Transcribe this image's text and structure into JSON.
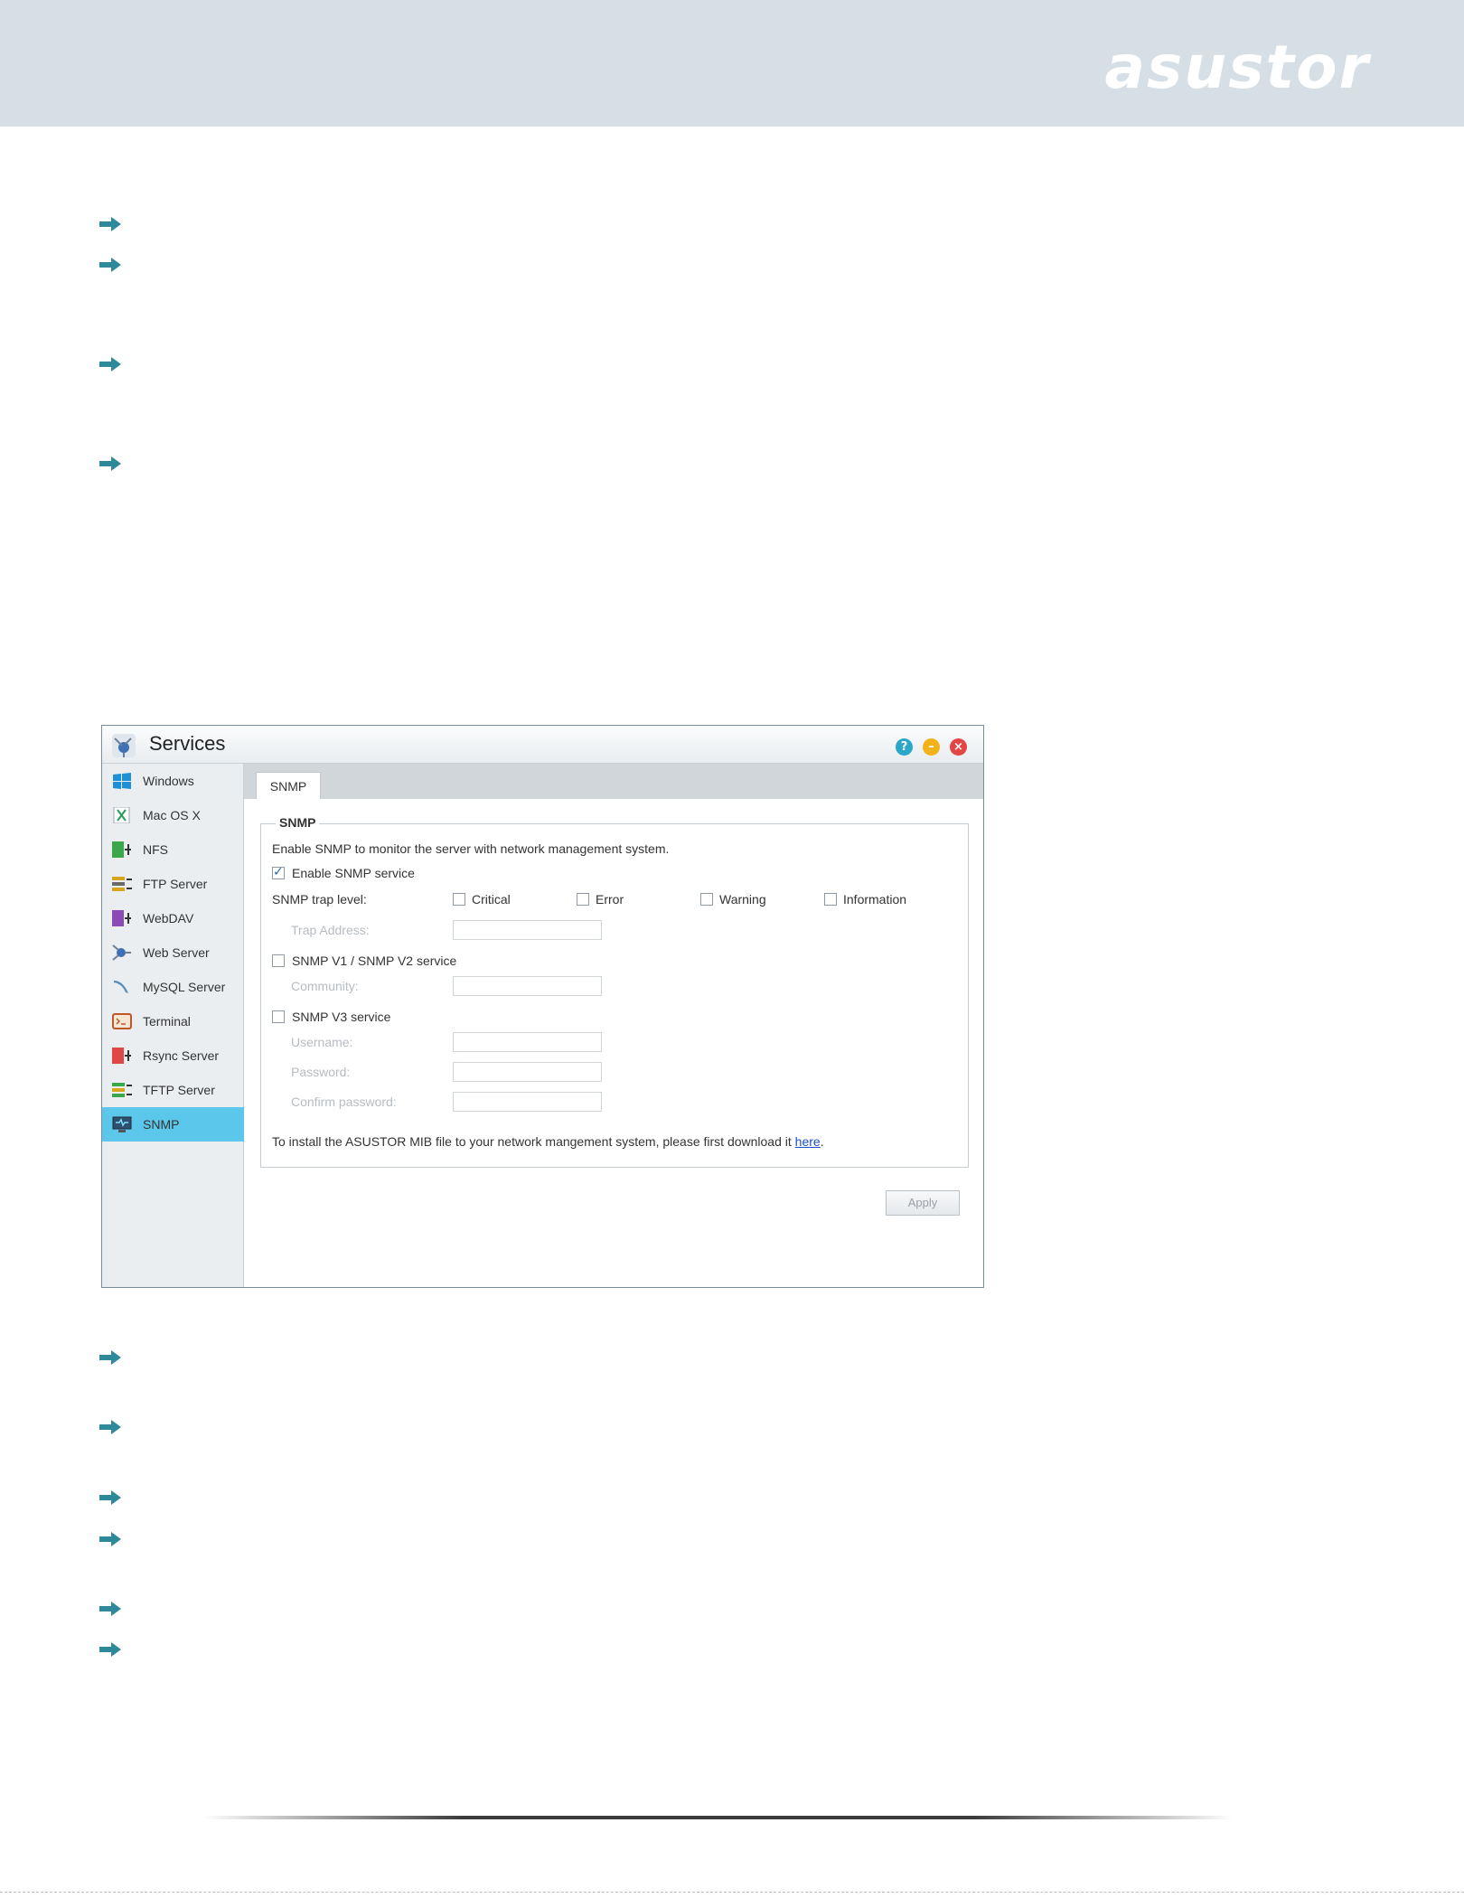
{
  "brand": {
    "logo_text": "asustor"
  },
  "window": {
    "title": "Services",
    "buttons": {
      "help": "?",
      "minimize": "–",
      "close": "×"
    }
  },
  "sidebar": {
    "items": [
      {
        "label": "Windows"
      },
      {
        "label": "Mac OS X"
      },
      {
        "label": "NFS"
      },
      {
        "label": "FTP Server"
      },
      {
        "label": "WebDAV"
      },
      {
        "label": "Web Server"
      },
      {
        "label": "MySQL Server"
      },
      {
        "label": "Terminal"
      },
      {
        "label": "Rsync Server"
      },
      {
        "label": "TFTP Server"
      },
      {
        "label": "SNMP",
        "active": true
      }
    ]
  },
  "tabs": [
    {
      "label": "SNMP",
      "active": true
    }
  ],
  "snmp": {
    "legend": "SNMP",
    "description": "Enable SNMP to monitor the server with network management system.",
    "enable_label": "Enable SNMP service",
    "enable_checked": true,
    "trap_level_label": "SNMP trap level:",
    "trap_levels": [
      {
        "label": "Critical",
        "checked": false
      },
      {
        "label": "Error",
        "checked": false
      },
      {
        "label": "Warning",
        "checked": false
      },
      {
        "label": "Information",
        "checked": false
      }
    ],
    "trap_address_label": "Trap Address:",
    "v1v2_label": "SNMP V1 / SNMP V2 service",
    "v1v2_checked": false,
    "community_label": "Community:",
    "v3_label": "SNMP V3 service",
    "v3_checked": false,
    "username_label": "Username:",
    "password_label": "Password:",
    "confirm_password_label": "Confirm password:",
    "mib_text": "To install the ASUSTOR MIB file to your network mangement system, please first download it",
    "mib_link": "here",
    "mib_suffix": ".",
    "apply_label": "Apply"
  },
  "colors": {
    "header_band": "#d5dfe5",
    "bullet_arrow": "#2e8a9a",
    "sidebar_active": "#5bc7ea",
    "link": "#1a4fcf"
  }
}
